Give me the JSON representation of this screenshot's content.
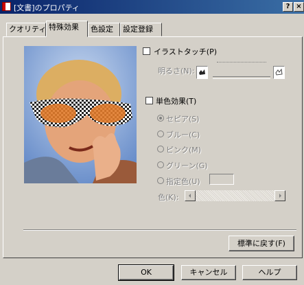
{
  "window": {
    "title": "[文書]のプロパティ",
    "help_button": "?",
    "close_button": "×"
  },
  "tabs": [
    {
      "label": "クオリティ"
    },
    {
      "label": "特殊効果"
    },
    {
      "label": "色設定"
    },
    {
      "label": "設定登録"
    }
  ],
  "effects": {
    "illustration_touch": {
      "label": "イラストタッチ(P)",
      "checked": false
    },
    "brightness": {
      "label": "明るさ(N):"
    },
    "monochrome": {
      "label": "単色効果(T)",
      "checked": false
    },
    "mono_options": [
      {
        "label": "セピア(S)",
        "selected": true
      },
      {
        "label": "ブルー(C)",
        "selected": false
      },
      {
        "label": "ピンク(M)",
        "selected": false
      },
      {
        "label": "グリーン(G)",
        "selected": false
      },
      {
        "label": "指定色(U)",
        "selected": false
      }
    ],
    "color": {
      "label": "色(K):"
    }
  },
  "buttons": {
    "reset": "標準に戻す(F)",
    "ok": "OK",
    "cancel": "キャンセル",
    "help": "ヘルプ"
  }
}
